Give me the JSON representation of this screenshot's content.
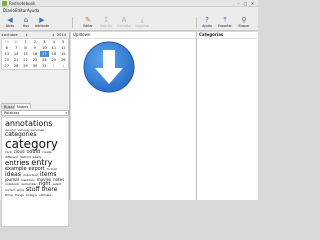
{
  "window": {
    "title": "Rednotebook",
    "minimize": "–",
    "maximize": "▢",
    "close": "✕"
  },
  "menu": [
    "Diario",
    "Editar",
    "Ayuda"
  ],
  "toolbar": [
    {
      "label": "Atrás",
      "icon": "◀",
      "name": "back",
      "disabled": false
    },
    {
      "label": "Hoy",
      "icon": "⌂",
      "name": "today",
      "disabled": false
    },
    {
      "label": "Adelante",
      "icon": "▶",
      "name": "forward",
      "disabled": false
    },
    {
      "label": "Editar",
      "icon": "✎",
      "name": "edit",
      "disabled": false
    },
    {
      "label": "Insertar",
      "icon": "↧",
      "name": "insert",
      "disabled": true
    },
    {
      "label": "Formato",
      "icon": "A",
      "name": "format",
      "disabled": true
    },
    {
      "label": "Importar",
      "icon": "⤓",
      "name": "import",
      "disabled": true
    },
    {
      "label": "Ayuda",
      "icon": "?",
      "name": "help",
      "disabled": false
    },
    {
      "label": "Exportar",
      "icon": "⤒",
      "name": "export",
      "disabled": false
    },
    {
      "label": "Buscar",
      "icon": "⚲",
      "name": "search",
      "disabled": false
    }
  ],
  "calendar": {
    "month": "octubre",
    "year": "2014",
    "weeks": [
      [
        "29",
        "30",
        "1",
        "2",
        "3",
        "4",
        "5"
      ],
      [
        "6",
        "7",
        "8",
        "9",
        "10",
        "11",
        "12"
      ],
      [
        "13",
        "14",
        "15",
        "16",
        "17",
        "18",
        "19"
      ],
      [
        "20",
        "21",
        "22",
        "23",
        "24",
        "25",
        "26"
      ],
      [
        "27",
        "28",
        "29",
        "30",
        "31",
        "1",
        "2"
      ]
    ],
    "selected": "17"
  },
  "tabs": [
    "Buscar",
    "Nubes"
  ],
  "dropdown": {
    "value": "Palabras"
  },
  "cloud": [
    {
      "t": "annotations",
      "s": 8
    },
    {
      "t": "around",
      "s": 3
    },
    {
      "t": "various",
      "s": 3
    },
    {
      "t": "becomes",
      "s": 3
    },
    {
      "t": "categories",
      "s": 6
    },
    {
      "t": "category",
      "s": 12
    },
    {
      "t": "click",
      "s": 3
    },
    {
      "t": "cloud",
      "s": 4
    },
    {
      "t": "could",
      "s": 5
    },
    {
      "t": "create",
      "s": 3
    },
    {
      "t": "different",
      "s": 3
    },
    {
      "t": "distinct",
      "s": 3
    },
    {
      "t": "easily",
      "s": 3
    },
    {
      "t": "entries",
      "s": 7
    },
    {
      "t": "entry",
      "s": 8
    },
    {
      "t": "example",
      "s": 5
    },
    {
      "t": "export",
      "s": 5
    },
    {
      "t": "format",
      "s": 3
    },
    {
      "t": "ideas",
      "s": 6
    },
    {
      "t": "important",
      "s": 3
    },
    {
      "t": "items",
      "s": 6
    },
    {
      "t": "journal",
      "s": 4
    },
    {
      "t": "mentions",
      "s": 3
    },
    {
      "t": "movies",
      "s": 4
    },
    {
      "t": "notes",
      "s": 4
    },
    {
      "t": "notebook",
      "s": 3
    },
    {
      "t": "remember",
      "s": 3
    },
    {
      "t": "right",
      "s": 5
    },
    {
      "t": "select",
      "s": 3
    },
    {
      "t": "sorted",
      "s": 3
    },
    {
      "t": "store",
      "s": 3
    },
    {
      "t": "stuff",
      "s": 6
    },
    {
      "t": "there",
      "s": 6
    },
    {
      "t": "thing",
      "s": 3
    },
    {
      "t": "things",
      "s": 3
    },
    {
      "t": "today's",
      "s": 3
    },
    {
      "t": "ultimate",
      "s": 3
    }
  ],
  "center": {
    "title": "Upldown"
  },
  "right": {
    "title": "Categorías"
  }
}
